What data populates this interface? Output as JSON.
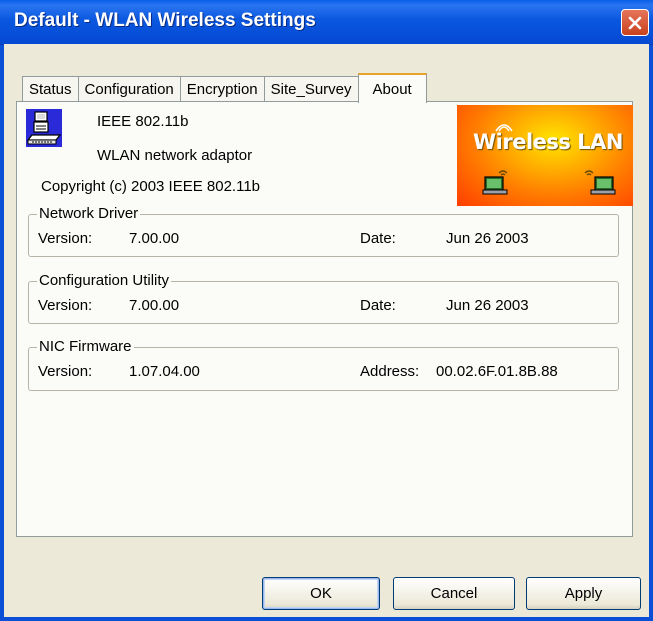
{
  "window": {
    "title": "Default - WLAN Wireless Settings",
    "close_icon": "close-icon"
  },
  "tabs": [
    {
      "label": "Status"
    },
    {
      "label": "Configuration"
    },
    {
      "label": "Encryption"
    },
    {
      "label": "Site_Survey"
    },
    {
      "label": "About",
      "active": true
    }
  ],
  "about": {
    "product_line1": "IEEE 802.11b",
    "product_line2": "WLAN network adaptor",
    "copyright": "Copyright (c) 2003  IEEE 802.11b",
    "banner_text": "Wireless LAN",
    "device_icon": "network-adaptor-icon",
    "banner_icons": [
      "wireless-laptop-icon",
      "wireless-laptop-icon"
    ]
  },
  "groups": {
    "network_driver": {
      "title": "Network Driver",
      "version_label": "Version:",
      "version": "7.00.00",
      "right_label": "Date:",
      "right_value": "Jun 26 2003"
    },
    "config_utility": {
      "title": "Configuration Utility",
      "version_label": "Version:",
      "version": "7.00.00",
      "right_label": "Date:",
      "right_value": "Jun 26 2003"
    },
    "nic_firmware": {
      "title": "NIC Firmware",
      "version_label": "Version:",
      "version": "1.07.04.00",
      "right_label": "Address:",
      "right_value": "00.02.6F.01.8B.88"
    }
  },
  "buttons": {
    "ok": "OK",
    "cancel": "Cancel",
    "apply": "Apply"
  },
  "colors": {
    "titlebar": "#0a58e0",
    "dialog_bg": "#ece9d8",
    "active_tab_accent": "#e6a22b",
    "banner": "#ff7a00",
    "close_button": "#d0532e"
  }
}
